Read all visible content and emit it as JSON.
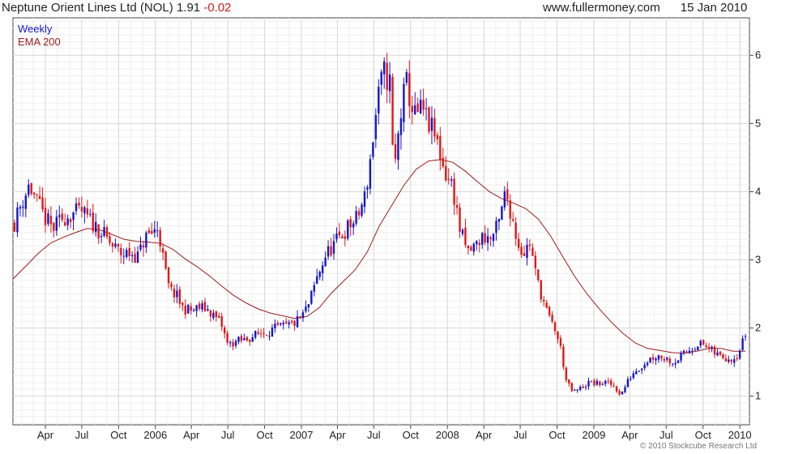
{
  "header": {
    "title": "Neptune Orient Lines Ltd (NOL)",
    "price": "1.91",
    "change": "-0.02",
    "site": "www.fullermoney.com",
    "date": "15 Jan 2010"
  },
  "copyright": "© 2010 Stockcube Research Ltd",
  "colors": {
    "up": "#1515c8",
    "down": "#e01818",
    "ema": "#9c1b1b",
    "grid": "#d8d8d8",
    "legend_weekly": "#1515c8",
    "legend_ema": "#9c1b1b"
  },
  "chart_data": {
    "type": "candlestick",
    "legend": [
      "Weekly",
      "EMA 200"
    ],
    "legend_position": "top-left",
    "grid": true,
    "y_axis_position": "right",
    "ylim": [
      0.58,
      6.55
    ],
    "yticks": [
      1,
      2,
      3,
      4,
      5,
      6
    ],
    "xlim": [
      "2005-01-10",
      "2010-01-25"
    ],
    "xticks": [
      {
        "label": "Apr",
        "date": "2005-04-01"
      },
      {
        "label": "Jul",
        "date": "2005-07-01"
      },
      {
        "label": "Oct",
        "date": "2005-10-01"
      },
      {
        "label": "2006",
        "date": "2006-01-01"
      },
      {
        "label": "Apr",
        "date": "2006-04-01"
      },
      {
        "label": "Jul",
        "date": "2006-07-01"
      },
      {
        "label": "Oct",
        "date": "2006-10-01"
      },
      {
        "label": "2007",
        "date": "2007-01-01"
      },
      {
        "label": "Apr",
        "date": "2007-04-01"
      },
      {
        "label": "Jul",
        "date": "2007-07-01"
      },
      {
        "label": "Oct",
        "date": "2007-10-01"
      },
      {
        "label": "2008",
        "date": "2008-01-01"
      },
      {
        "label": "Apr",
        "date": "2008-04-01"
      },
      {
        "label": "Jul",
        "date": "2008-07-01"
      },
      {
        "label": "Oct",
        "date": "2008-10-01"
      },
      {
        "label": "2009",
        "date": "2009-01-01"
      },
      {
        "label": "Apr",
        "date": "2009-04-01"
      },
      {
        "label": "Jul",
        "date": "2009-07-01"
      },
      {
        "label": "Oct",
        "date": "2009-10-01"
      },
      {
        "label": "2010",
        "date": "2010-01-01"
      }
    ],
    "price_path": [
      [
        "2005-01-14",
        3.55
      ],
      [
        "2005-02-01",
        3.85
      ],
      [
        "2005-02-20",
        4.1
      ],
      [
        "2005-03-10",
        3.85
      ],
      [
        "2005-04-01",
        3.6
      ],
      [
        "2005-04-20",
        3.45
      ],
      [
        "2005-05-15",
        3.62
      ],
      [
        "2005-06-10",
        3.68
      ],
      [
        "2005-07-01",
        3.7
      ],
      [
        "2005-07-25",
        3.55
      ],
      [
        "2005-08-20",
        3.4
      ],
      [
        "2005-09-15",
        3.2
      ],
      [
        "2005-10-10",
        3.08
      ],
      [
        "2005-10-30",
        3.1
      ],
      [
        "2005-11-20",
        3.05
      ],
      [
        "2005-12-05",
        3.32
      ],
      [
        "2005-12-25",
        3.4
      ],
      [
        "2006-01-08",
        3.48
      ],
      [
        "2006-01-22",
        2.95
      ],
      [
        "2006-02-05",
        2.55
      ],
      [
        "2006-02-20",
        2.5
      ],
      [
        "2006-03-10",
        2.3
      ],
      [
        "2006-04-01",
        2.25
      ],
      [
        "2006-04-20",
        2.3
      ],
      [
        "2006-05-10",
        2.28
      ],
      [
        "2006-05-25",
        2.2
      ],
      [
        "2006-06-15",
        2.05
      ],
      [
        "2006-07-01",
        1.75
      ],
      [
        "2006-07-20",
        1.8
      ],
      [
        "2006-08-10",
        1.82
      ],
      [
        "2006-09-01",
        1.88
      ],
      [
        "2006-09-20",
        1.92
      ],
      [
        "2006-10-10",
        1.95
      ],
      [
        "2006-11-01",
        2.0
      ],
      [
        "2006-11-20",
        2.02
      ],
      [
        "2006-12-10",
        2.05
      ],
      [
        "2007-01-01",
        2.15
      ],
      [
        "2007-01-20",
        2.35
      ],
      [
        "2007-02-10",
        2.75
      ],
      [
        "2007-03-01",
        3.05
      ],
      [
        "2007-03-20",
        3.2
      ],
      [
        "2007-04-10",
        3.35
      ],
      [
        "2007-05-01",
        3.5
      ],
      [
        "2007-05-20",
        3.6
      ],
      [
        "2007-06-10",
        3.95
      ],
      [
        "2007-06-25",
        4.6
      ],
      [
        "2007-07-10",
        5.3
      ],
      [
        "2007-07-25",
        5.75
      ],
      [
        "2007-08-10",
        5.6
      ],
      [
        "2007-08-20",
        4.2
      ],
      [
        "2007-09-05",
        5.1
      ],
      [
        "2007-09-20",
        5.6
      ],
      [
        "2007-10-10",
        5.1
      ],
      [
        "2007-10-30",
        5.2
      ],
      [
        "2007-11-15",
        5.0
      ],
      [
        "2007-12-05",
        4.75
      ],
      [
        "2007-12-25",
        4.3
      ],
      [
        "2008-01-15",
        4.05
      ],
      [
        "2008-02-01",
        3.45
      ],
      [
        "2008-02-20",
        3.1
      ],
      [
        "2008-03-10",
        3.2
      ],
      [
        "2008-03-30",
        3.35
      ],
      [
        "2008-04-20",
        3.3
      ],
      [
        "2008-05-10",
        3.55
      ],
      [
        "2008-05-25",
        4.0
      ],
      [
        "2008-06-10",
        3.65
      ],
      [
        "2008-06-25",
        3.25
      ],
      [
        "2008-07-10",
        3.1
      ],
      [
        "2008-07-25",
        3.25
      ],
      [
        "2008-08-10",
        2.75
      ],
      [
        "2008-08-25",
        2.45
      ],
      [
        "2008-09-10",
        2.15
      ],
      [
        "2008-09-25",
        2.0
      ],
      [
        "2008-10-10",
        1.7
      ],
      [
        "2008-10-25",
        1.2
      ],
      [
        "2008-11-10",
        1.05
      ],
      [
        "2008-11-30",
        1.12
      ],
      [
        "2008-12-20",
        1.2
      ],
      [
        "2009-01-10",
        1.18
      ],
      [
        "2009-02-01",
        1.2
      ],
      [
        "2009-02-20",
        1.15
      ],
      [
        "2009-03-10",
        1.02
      ],
      [
        "2009-03-25",
        1.2
      ],
      [
        "2009-04-10",
        1.35
      ],
      [
        "2009-05-01",
        1.45
      ],
      [
        "2009-05-20",
        1.55
      ],
      [
        "2009-06-10",
        1.6
      ],
      [
        "2009-07-01",
        1.55
      ],
      [
        "2009-07-20",
        1.5
      ],
      [
        "2009-08-10",
        1.6
      ],
      [
        "2009-09-01",
        1.7
      ],
      [
        "2009-09-20",
        1.78
      ],
      [
        "2009-10-10",
        1.72
      ],
      [
        "2009-11-01",
        1.62
      ],
      [
        "2009-11-20",
        1.58
      ],
      [
        "2009-12-10",
        1.55
      ],
      [
        "2009-12-28",
        1.62
      ],
      [
        "2010-01-08",
        1.8
      ],
      [
        "2010-01-15",
        1.91
      ]
    ],
    "ema_200": [
      [
        "2005-01-10",
        2.72
      ],
      [
        "2005-02-15",
        2.93
      ],
      [
        "2005-03-15",
        3.1
      ],
      [
        "2005-04-15",
        3.25
      ],
      [
        "2005-05-15",
        3.33
      ],
      [
        "2005-06-15",
        3.4
      ],
      [
        "2005-07-15",
        3.46
      ],
      [
        "2005-08-15",
        3.44
      ],
      [
        "2005-09-15",
        3.37
      ],
      [
        "2005-10-15",
        3.3
      ],
      [
        "2005-11-15",
        3.27
      ],
      [
        "2005-12-15",
        3.26
      ],
      [
        "2006-01-15",
        3.24
      ],
      [
        "2006-02-15",
        3.15
      ],
      [
        "2006-03-15",
        3.02
      ],
      [
        "2006-04-15",
        2.9
      ],
      [
        "2006-05-15",
        2.77
      ],
      [
        "2006-06-15",
        2.62
      ],
      [
        "2006-07-15",
        2.48
      ],
      [
        "2006-08-15",
        2.37
      ],
      [
        "2006-09-15",
        2.28
      ],
      [
        "2006-10-15",
        2.22
      ],
      [
        "2006-11-15",
        2.18
      ],
      [
        "2006-12-15",
        2.14
      ],
      [
        "2007-01-15",
        2.17
      ],
      [
        "2007-02-15",
        2.3
      ],
      [
        "2007-03-15",
        2.5
      ],
      [
        "2007-04-15",
        2.68
      ],
      [
        "2007-05-15",
        2.85
      ],
      [
        "2007-06-15",
        3.12
      ],
      [
        "2007-07-15",
        3.5
      ],
      [
        "2007-08-15",
        3.8
      ],
      [
        "2007-09-15",
        4.1
      ],
      [
        "2007-10-15",
        4.33
      ],
      [
        "2007-11-15",
        4.45
      ],
      [
        "2007-12-15",
        4.47
      ],
      [
        "2008-01-15",
        4.43
      ],
      [
        "2008-02-15",
        4.3
      ],
      [
        "2008-03-15",
        4.15
      ],
      [
        "2008-04-15",
        4.0
      ],
      [
        "2008-05-15",
        3.9
      ],
      [
        "2008-06-15",
        3.83
      ],
      [
        "2008-07-15",
        3.75
      ],
      [
        "2008-08-15",
        3.6
      ],
      [
        "2008-09-15",
        3.35
      ],
      [
        "2008-10-15",
        3.05
      ],
      [
        "2008-11-15",
        2.75
      ],
      [
        "2008-12-15",
        2.5
      ],
      [
        "2009-01-15",
        2.28
      ],
      [
        "2009-02-15",
        2.08
      ],
      [
        "2009-03-15",
        1.92
      ],
      [
        "2009-04-15",
        1.78
      ],
      [
        "2009-05-15",
        1.7
      ],
      [
        "2009-06-15",
        1.67
      ],
      [
        "2009-07-15",
        1.64
      ],
      [
        "2009-08-15",
        1.63
      ],
      [
        "2009-09-15",
        1.66
      ],
      [
        "2009-10-15",
        1.7
      ],
      [
        "2009-11-15",
        1.7
      ],
      [
        "2009-12-15",
        1.66
      ],
      [
        "2010-01-15",
        1.66
      ]
    ]
  }
}
